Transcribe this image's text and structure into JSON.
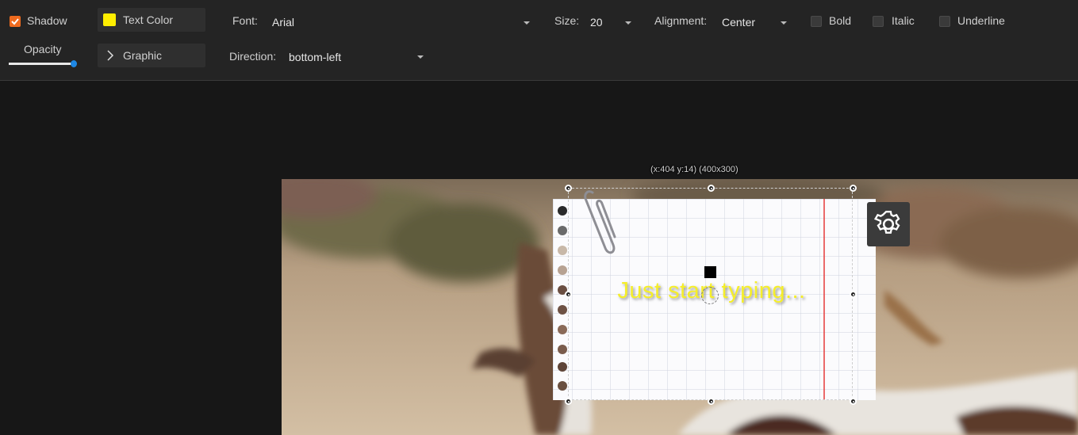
{
  "toolbar": {
    "shadow_label": "Shadow",
    "shadow_checked": true,
    "text_color_label": "Text Color",
    "text_color": "#ffee00",
    "font_label": "Font:",
    "font_value": "Arial",
    "size_label": "Size:",
    "size_value": "20",
    "alignment_label": "Alignment:",
    "alignment_value": "Center",
    "bold_label": "Bold",
    "italic_label": "Italic",
    "underline_label": "Underline",
    "opacity_label": "Opacity",
    "opacity_level": 0.98,
    "graphic_label": "Graphic",
    "direction_label": "Direction:",
    "direction_value": "bottom-left"
  },
  "editor": {
    "coords_readout": "(x:404 y:14) (400x300)",
    "text_content": "Just start typing...",
    "settings_icon": "gear-icon"
  },
  "colors": {
    "accent": "#ee6a1e",
    "slider": "#1e88e5",
    "text_yellow": "#f5ee2a"
  }
}
